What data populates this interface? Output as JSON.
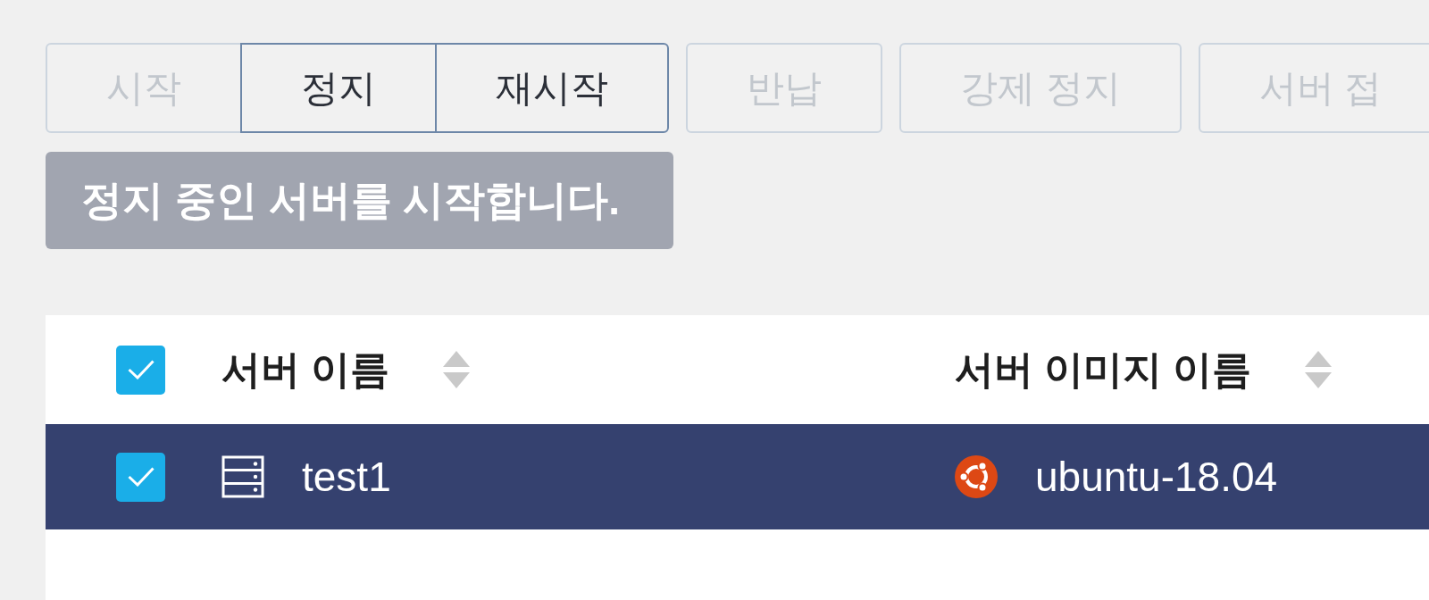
{
  "toolbar": {
    "groups": [
      {
        "buttons": [
          {
            "label": "시작",
            "disabled": true
          },
          {
            "label": "정지",
            "disabled": false
          },
          {
            "label": "재시작",
            "disabled": false
          }
        ]
      },
      {
        "buttons": [
          {
            "label": "반납",
            "disabled": true
          }
        ]
      },
      {
        "buttons": [
          {
            "label": "강제 정지",
            "disabled": true
          }
        ]
      },
      {
        "buttons": [
          {
            "label": "서버 접",
            "disabled": true
          }
        ]
      }
    ]
  },
  "tooltip": {
    "text": "정지 중인 서버를 시작합니다."
  },
  "table": {
    "select_all": {
      "checked": true
    },
    "columns": [
      {
        "label": "서버 이름"
      },
      {
        "label": "서버 이미지 이름"
      }
    ],
    "rows": [
      {
        "selected": true,
        "checked": true,
        "name": "test1",
        "image": "ubuntu-18.04"
      }
    ]
  }
}
